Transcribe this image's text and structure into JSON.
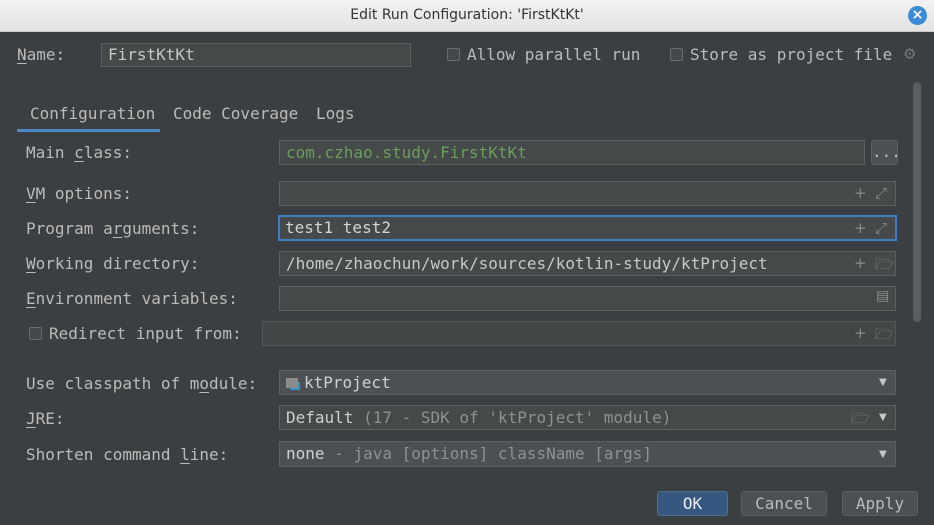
{
  "window": {
    "title": "Edit Run Configuration: 'FirstKtKt'"
  },
  "header": {
    "name_label": "Name:",
    "name_value": "FirstKtKt",
    "allow_parallel_label": "Allow parallel run",
    "store_project_label": "Store as project file"
  },
  "tabs": [
    {
      "label": "Configuration",
      "active": true
    },
    {
      "label": "Code Coverage",
      "active": false
    },
    {
      "label": "Logs",
      "active": false
    }
  ],
  "form": {
    "main_class_label": "Main class:",
    "main_class_value": "com.czhao.study.FirstKtKt",
    "browse_label": "...",
    "vm_options_label": "VM options:",
    "vm_options_value": "",
    "program_args_label": "Program arguments:",
    "program_args_value": "test1 test2",
    "working_dir_label": "Working directory:",
    "working_dir_value": "/home/zhaochun/work/sources/kotlin-study/ktProject",
    "env_vars_label": "Environment variables:",
    "env_vars_value": "",
    "redirect_label": "Redirect input from:",
    "redirect_value": "",
    "classpath_label": "Use classpath of module:",
    "classpath_value": "ktProject",
    "jre_label": "JRE:",
    "jre_value": "Default",
    "jre_hint": "(17 - SDK of 'ktProject' module)",
    "shorten_label": "Shorten command line:",
    "shorten_value": "none",
    "shorten_hint": "- java [options] className [args]"
  },
  "buttons": {
    "ok": "OK",
    "cancel": "Cancel",
    "apply": "Apply"
  },
  "colors": {
    "background": "#3c3f41",
    "accent": "#3d7ec7",
    "class_text": "#6a9e5b"
  }
}
